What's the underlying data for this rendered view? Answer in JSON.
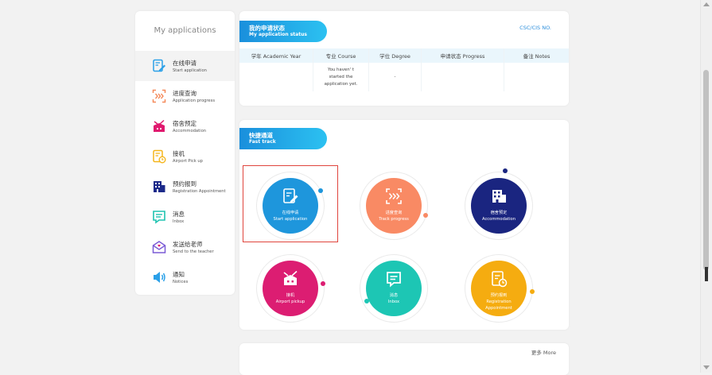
{
  "sidebar": {
    "title": "My applications",
    "items": [
      {
        "cn": "在线申请",
        "en": "Start application",
        "icon": "edit-document-icon",
        "color": "#2aa0e8",
        "active": true
      },
      {
        "cn": "进度查询",
        "en": "Application progress",
        "icon": "progress-icon",
        "color": "#f58b5c"
      },
      {
        "cn": "宿舍预定",
        "en": "Accommodation",
        "icon": "dormitory-icon",
        "color": "#e0186e"
      },
      {
        "cn": "接机",
        "en": "Airport Pick up",
        "icon": "airport-pickup-icon",
        "color": "#f5b51a"
      },
      {
        "cn": "预约报到",
        "en": "Registration Appointment",
        "icon": "building-icon",
        "color": "#1c2a8a"
      },
      {
        "cn": "消息",
        "en": "Inbox",
        "icon": "message-icon",
        "color": "#1fc3b0"
      },
      {
        "cn": "发送给老师",
        "en": "Send to the teacher",
        "icon": "mail-icon",
        "color": "#7b5cd6"
      },
      {
        "cn": "通知",
        "en": "Notices",
        "icon": "speaker-icon",
        "color": "#2aa0e8"
      }
    ]
  },
  "status": {
    "badge_cn": "我的申请状态",
    "badge_en": "My application status",
    "csc_link": "CSC/CIS NO.",
    "columns": [
      "学年 Academic Year",
      "专业 Course",
      "学位 Degree",
      "申请状态 Progress",
      "备注 Notes"
    ],
    "row": [
      "",
      "You haven' t started the application yet.",
      "-",
      "",
      ""
    ]
  },
  "fast_track": {
    "badge_cn": "快捷通道",
    "badge_en": "Fast track",
    "tiles": [
      {
        "cn": "在线申请",
        "en": "Start application",
        "color": "#1e96dc",
        "icon": "edit-document-icon"
      },
      {
        "cn": "进度查询",
        "en": "Track progress",
        "color": "#f98a64",
        "icon": "progress-icon"
      },
      {
        "cn": "宿舍预定",
        "en": "Accommodation",
        "color": "#1a2580",
        "icon": "dormitory-icon"
      },
      {
        "cn": "接机",
        "en": "Airport pickup",
        "color": "#dc1d72",
        "icon": "airport-pickup-icon"
      },
      {
        "cn": "消息",
        "en": "Inbox",
        "color": "#1dc6b4",
        "icon": "message-icon"
      },
      {
        "cn": "预约报到",
        "en": "Registration Appointment",
        "color": "#f5ac10",
        "icon": "registration-icon"
      }
    ]
  },
  "more": {
    "label": "更多 More"
  }
}
